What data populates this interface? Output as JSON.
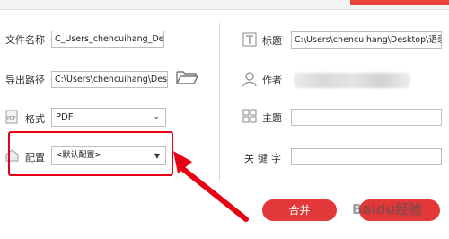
{
  "left": {
    "file_name": {
      "label": "文件名称",
      "value": "C_Users_chencuihang_Desktop_语录_"
    },
    "export_path": {
      "label": "导出路径",
      "value": "C:\\Users\\chencuihang\\Desktop"
    },
    "format": {
      "label": "格式",
      "value": "PDF"
    },
    "config": {
      "label": "配置",
      "value": "<默认配置>"
    }
  },
  "right": {
    "title": {
      "label": "标题",
      "value": "C:\\Users\\chencuihang\\Desktop\\语录\\"
    },
    "author": {
      "label": "作者",
      "value": ""
    },
    "subject": {
      "label": "主题",
      "value": ""
    },
    "keywords": {
      "label": "关键字",
      "value": ""
    }
  },
  "buttons": {
    "merge": "合并",
    "cancel": "Baidu经验"
  },
  "colors": {
    "accent": "#e2383a",
    "highlight": "#e60012"
  }
}
